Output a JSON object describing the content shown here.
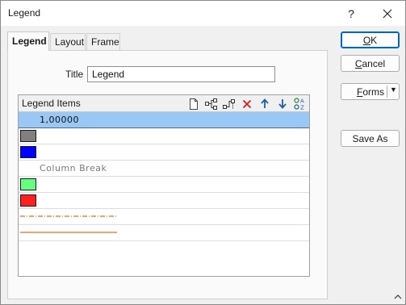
{
  "window": {
    "title": "Legend",
    "help_label": "?"
  },
  "tabs": [
    {
      "label": "Legend",
      "active": true
    },
    {
      "label": "Layout",
      "active": false
    },
    {
      "label": "Frame",
      "active": false
    }
  ],
  "form": {
    "title_label": "Title",
    "title_value": "Legend"
  },
  "legend_items": {
    "header": "Legend Items",
    "toolbar_icons": [
      "new-item-icon",
      "add-branch-icon",
      "add-sub-item-icon",
      "delete-icon",
      "move-up-icon",
      "move-down-icon",
      "sort-az-icon"
    ],
    "rows": [
      {
        "type": "text",
        "text": "1,00000",
        "selected": true
      },
      {
        "type": "swatch",
        "color": "#808080"
      },
      {
        "type": "swatch",
        "color": "#0000ff"
      },
      {
        "type": "text",
        "text": "Column  Break",
        "dim": true
      },
      {
        "type": "swatch",
        "color": "#66ff80"
      },
      {
        "type": "swatch",
        "color": "#ff2020"
      },
      {
        "type": "line",
        "style": "dashdot",
        "color": "#e07020"
      },
      {
        "type": "line",
        "style": "solid",
        "color": "#e07020"
      }
    ]
  },
  "buttons": {
    "ok": "OK",
    "cancel": "Cancel",
    "forms": "Forms",
    "save_as": "Save As"
  },
  "colors": {
    "accent": "#0067c0",
    "selection": "#99c8f5"
  }
}
